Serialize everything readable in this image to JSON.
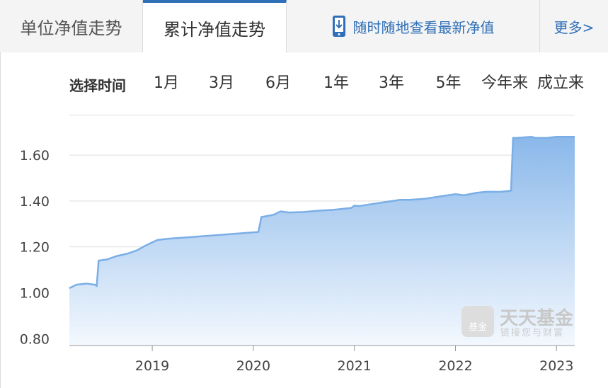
{
  "tabs": {
    "unit_nav": "单位净值走势",
    "cumulative_nav": "累计净值走势",
    "promo": "随时随地查看最新净值",
    "more": "更多>"
  },
  "range_selector": {
    "label": "选择时间",
    "options": [
      "1月",
      "3月",
      "6月",
      "1年",
      "3年",
      "5年",
      "今年来",
      "成立来"
    ],
    "active": "5年"
  },
  "watermark": {
    "logo_text": "基金",
    "brand": "天天基金",
    "slogan": "链接您与财富"
  },
  "colors": {
    "accent": "#2f6fb7",
    "active_range": "#4a78b8",
    "line": "#7aaee6",
    "fill_top": "#8ab8ea",
    "fill_bottom": "#f3f8fe"
  },
  "chart_data": {
    "type": "area",
    "y_ticks": [
      "0.80",
      "1.00",
      "1.20",
      "1.40",
      "1.60"
    ],
    "x_ticks": [
      "2019",
      "2020",
      "2021",
      "2022",
      "2023"
    ],
    "ylim": [
      0.77,
      1.77
    ],
    "xlim": [
      2018.18,
      2023.18
    ],
    "x_tick_values": [
      2019,
      2020,
      2021,
      2022,
      2023
    ],
    "y_tick_values": [
      0.8,
      1.0,
      1.2,
      1.4,
      1.6
    ],
    "grid": true,
    "x": [
      2018.18,
      2018.25,
      2018.35,
      2018.43,
      2018.45,
      2018.47,
      2018.55,
      2018.65,
      2018.75,
      2018.85,
      2018.93,
      2019.05,
      2019.15,
      2019.3,
      2019.45,
      2019.6,
      2019.75,
      2019.9,
      2020.05,
      2020.08,
      2020.2,
      2020.27,
      2020.35,
      2020.5,
      2020.65,
      2020.8,
      2020.97,
      2021.0,
      2021.05,
      2021.15,
      2021.3,
      2021.45,
      2021.55,
      2021.7,
      2021.85,
      2022.0,
      2022.08,
      2022.2,
      2022.3,
      2022.45,
      2022.55,
      2022.57,
      2022.6,
      2022.75,
      2022.8,
      2022.9,
      2023.0,
      2023.18
    ],
    "values": [
      1.02,
      1.035,
      1.04,
      1.035,
      1.03,
      1.14,
      1.145,
      1.16,
      1.17,
      1.185,
      1.205,
      1.23,
      1.235,
      1.24,
      1.245,
      1.25,
      1.255,
      1.26,
      1.265,
      1.33,
      1.34,
      1.355,
      1.35,
      1.352,
      1.358,
      1.362,
      1.37,
      1.38,
      1.378,
      1.385,
      1.395,
      1.405,
      1.405,
      1.41,
      1.42,
      1.43,
      1.425,
      1.435,
      1.44,
      1.44,
      1.445,
      1.675,
      1.675,
      1.68,
      1.675,
      1.675,
      1.68,
      1.68
    ]
  }
}
